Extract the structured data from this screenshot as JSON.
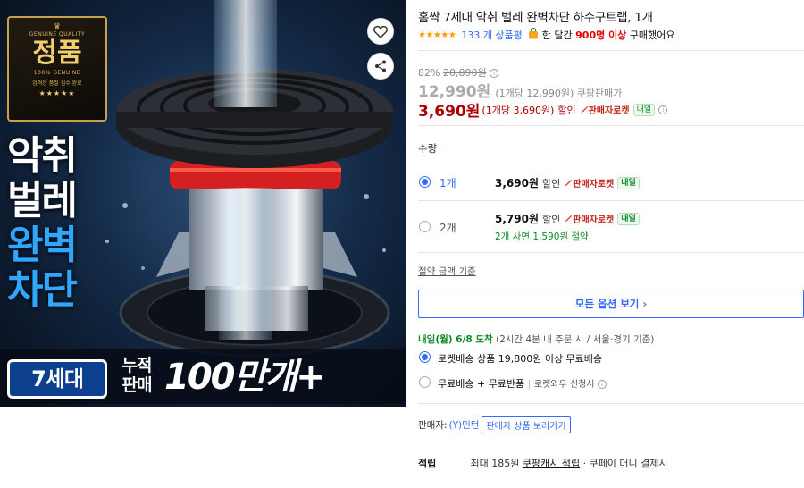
{
  "image_banner": {
    "badge_top": "GENUINE QUALITY",
    "badge_main": "정품",
    "badge_sub": "100% GENUINE",
    "badge_sub2": "엄격한 품질 검수 완료",
    "badge_stars": "★★★★★",
    "headline_line1": "악취",
    "headline_line2": "벌레",
    "headline_line3": "완벽",
    "headline_line4": "차단",
    "generation": "7세대",
    "cumulative_line1": "누적",
    "cumulative_line2": "판매",
    "sales_count": "100만개+"
  },
  "product": {
    "title": "홈싹 7세대 악취 벌레 완벽차단 하수구트랩, 1개",
    "stars": "★★★★★",
    "review_count": "133 개 상품평",
    "buyers_prefix": "한 달간",
    "buyers_count": "900명 이상",
    "buyers_suffix": "구매했어요"
  },
  "price": {
    "discount_rate": "82%",
    "original_price": "20,890원",
    "coupang_price": "12,990원",
    "coupang_unit": "(1개당 12,990원) 쿠팡판매가",
    "sale_price": "3,690원",
    "sale_unit": "(1개당 3,690원)",
    "sale_label": "할인",
    "rocket_label": "판매자로켓",
    "tomorrow": "내일"
  },
  "quantity": {
    "label": "수량",
    "options": [
      {
        "qty": "1개",
        "price": "3,690원",
        "disc": "할인",
        "rocket": "판매자로켓",
        "tomorrow": "내일",
        "sub": "",
        "selected": true
      },
      {
        "qty": "2개",
        "price": "5,790원",
        "disc": "할인",
        "rocket": "판매자로켓",
        "tomorrow": "내일",
        "sub": "2개 사면 1,590원 절약",
        "selected": false
      }
    ],
    "save_basis": "절약 금액 기준",
    "all_options": "모든 옵션 보기 ›"
  },
  "delivery": {
    "date": "내일(월) 6/8 도착",
    "note": "(2시간 4분 내 주문 시 / 서울·경기 기준)",
    "option1": "로켓배송 상품 19,800원 이상 무료배송",
    "option2_main": "무료배송 + 무료반품",
    "option2_sep": "|",
    "option2_note": "로켓와우 신청시"
  },
  "seller": {
    "label": "판매자:",
    "name": "(Y)민턴",
    "tag": "판매자 상품 보러가기"
  },
  "points": {
    "label": "적립",
    "prefix": "최대 185원",
    "link": "쿠팡캐시 적립",
    "suffix": "· 쿠페이 머니 결제시"
  },
  "colors": {
    "link_blue": "#346aff",
    "sale_red": "#ae0000",
    "green": "#0a8b25",
    "star_orange": "#ff9b00"
  },
  "icons": [
    "heart-icon",
    "share-icon",
    "info-icon",
    "bag-icon",
    "rocket-icon",
    "chevron-right-icon"
  ]
}
